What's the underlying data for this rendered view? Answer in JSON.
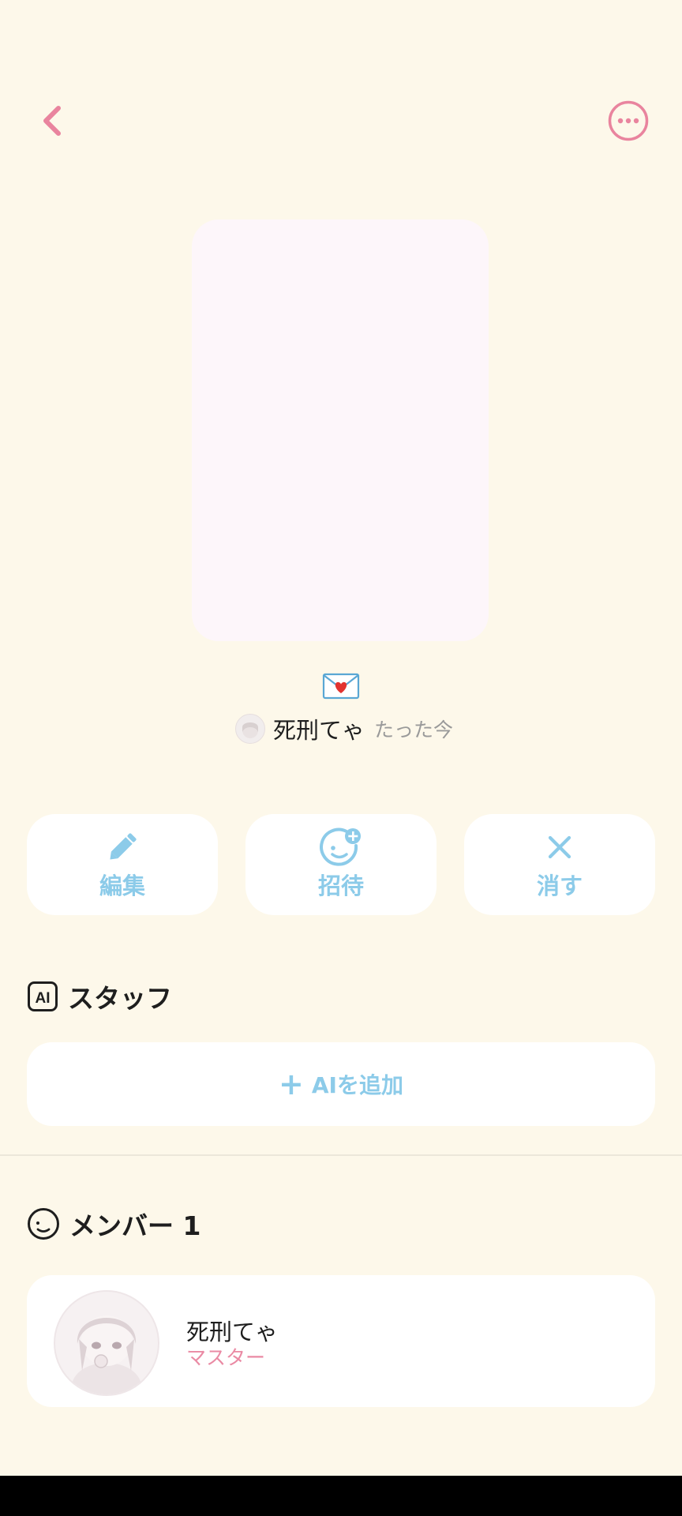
{
  "colors": {
    "background": "#fdf8ea",
    "accent_pink": "#e9849e",
    "accent_blue": "#8ccbe9",
    "card_bg": "#ffffff"
  },
  "topbar": {
    "back_icon": "chevron-left-icon",
    "more_icon": "more-horizontal-icon"
  },
  "post": {
    "emoji": "💌",
    "author_name": "死刑てゃ",
    "time": "たった今"
  },
  "actions": [
    {
      "label": "編集",
      "icon": "pencil-icon"
    },
    {
      "label": "招待",
      "icon": "invite-face-plus-icon"
    },
    {
      "label": "消す",
      "icon": "close-icon"
    }
  ],
  "staff": {
    "title": "スタッフ",
    "icon": "ai-icon",
    "icon_text": "AI",
    "add_label": "AIを追加"
  },
  "members": {
    "title": "メンバー 1",
    "icon": "smile-icon",
    "items": [
      {
        "name": "死刑てゃ",
        "role": "マスター"
      }
    ]
  }
}
